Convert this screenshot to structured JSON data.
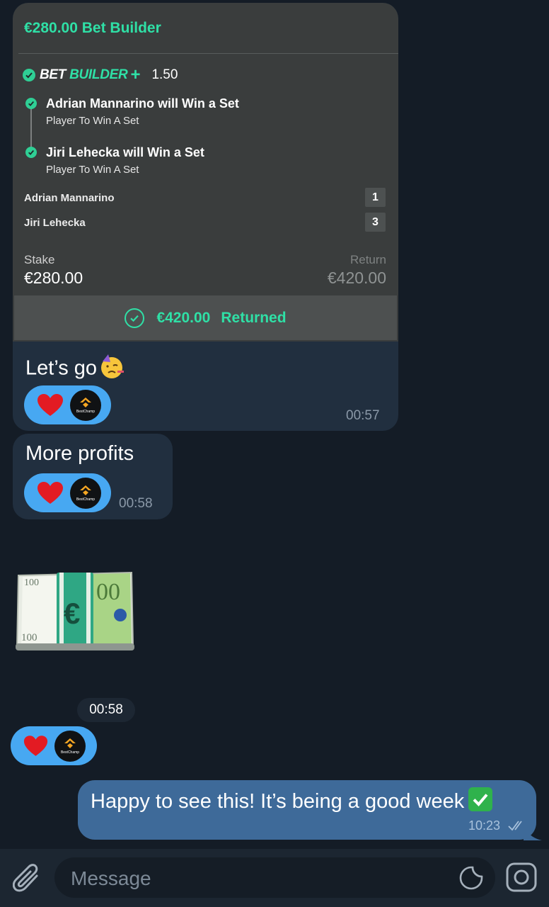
{
  "bet_card": {
    "header": "€280.00 Bet Builder",
    "builder_label_white": "BET ",
    "builder_label_green": "BUILDER",
    "builder_plus": "+",
    "odds": "1.50",
    "selections": [
      {
        "title": "Adrian Mannarino will Win a Set",
        "market": "Player To Win A Set"
      },
      {
        "title": "Jiri Lehecka will Win a Set",
        "market": "Player To Win A Set"
      }
    ],
    "scores": [
      {
        "player": "Adrian Mannarino",
        "sets": "1"
      },
      {
        "player": "Jiri Lehecka",
        "sets": "3"
      }
    ],
    "stake_label": "Stake",
    "stake_value": "€280.00",
    "return_label": "Return",
    "return_value": "€420.00",
    "returned_amount": "€420.00",
    "returned_text": "Returned"
  },
  "messages": [
    {
      "text": "Let’s go",
      "time": "00:57"
    },
    {
      "text": "More profits",
      "time": "00:58"
    },
    {
      "sticker": "euro-banknotes-sticker",
      "time": "00:58"
    }
  ],
  "reaction_avatar_text": "BestChamp",
  "outgoing": {
    "text": "Happy to see this! It’s being a good week",
    "emoji": "✓",
    "time": "10:23"
  },
  "composer": {
    "placeholder": "Message"
  },
  "colors": {
    "background": "#141c26",
    "incoming_bubble": "#212f3f",
    "outgoing_bubble": "#3e6a99",
    "accent_green": "#2fe0a6",
    "reaction_blue": "#47a8f2"
  },
  "icons": [
    "paperclip-icon",
    "sticker-icon",
    "camera-icon",
    "heart-icon",
    "double-check-icon",
    "check-circle-icon"
  ]
}
